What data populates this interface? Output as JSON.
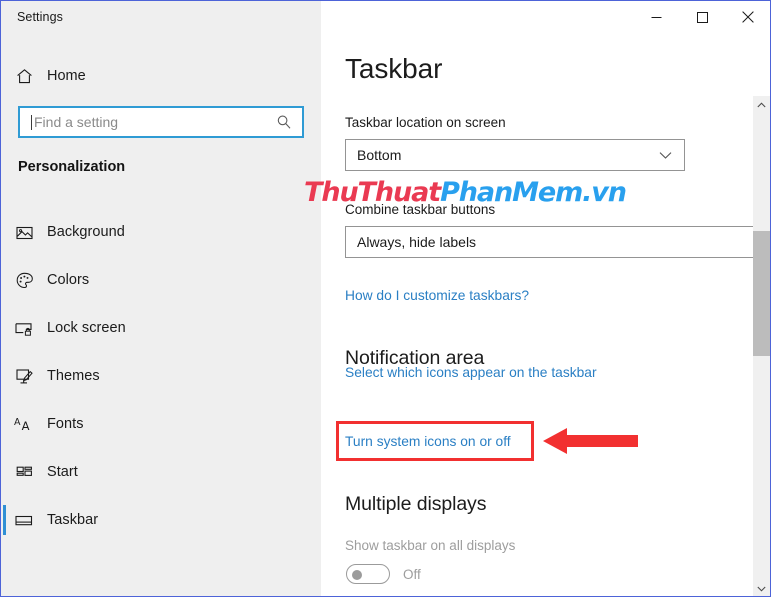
{
  "window": {
    "title": "Settings",
    "controls": [
      {
        "name": "minimize",
        "glyph": "minimize-icon"
      },
      {
        "name": "maximize",
        "glyph": "maximize-icon"
      },
      {
        "name": "close",
        "glyph": "close-icon"
      }
    ]
  },
  "sidebar": {
    "home": {
      "label": "Home",
      "icon": "home-icon"
    },
    "search": {
      "value": "",
      "placeholder": "Find a setting",
      "icon": "search-icon"
    },
    "section": "Personalization",
    "items": [
      {
        "label": "Background",
        "icon": "image-icon",
        "selected": false
      },
      {
        "label": "Colors",
        "icon": "palette-icon",
        "selected": false
      },
      {
        "label": "Lock screen",
        "icon": "lock-screen-icon",
        "selected": false
      },
      {
        "label": "Themes",
        "icon": "themes-icon",
        "selected": false
      },
      {
        "label": "Fonts",
        "icon": "fonts-icon",
        "selected": false
      },
      {
        "label": "Start",
        "icon": "start-icon",
        "selected": false
      },
      {
        "label": "Taskbar",
        "icon": "taskbar-icon",
        "selected": true
      }
    ]
  },
  "main": {
    "page_title": "Taskbar",
    "location_label": "Taskbar location on screen",
    "location_value": "Bottom",
    "combine_label": "Combine taskbar buttons",
    "combine_value": "Always, hide labels",
    "customize_link": "How do I customize taskbars?",
    "notification_heading": "Notification area",
    "select_icons_link": "Select which icons appear on the taskbar",
    "system_icons_link": "Turn system icons on or off",
    "multiple_displays_heading": "Multiple displays",
    "show_taskbar_label": "Show taskbar on all displays",
    "toggle_state": "Off"
  },
  "watermark": {
    "part1": "ThuThuat",
    "part2": "PhanMem.vn",
    "color1": "#ea3a52",
    "color2": "#29a0ee"
  },
  "annotation": {
    "highlight_color": "#f23030",
    "arrow_color": "#f23030",
    "target": "Turn system icons on or off"
  },
  "scrollbar": {
    "up_icon": "chevron-up-icon",
    "down_icon": "chevron-down-icon",
    "thumb": "scrollbar-thumb"
  }
}
